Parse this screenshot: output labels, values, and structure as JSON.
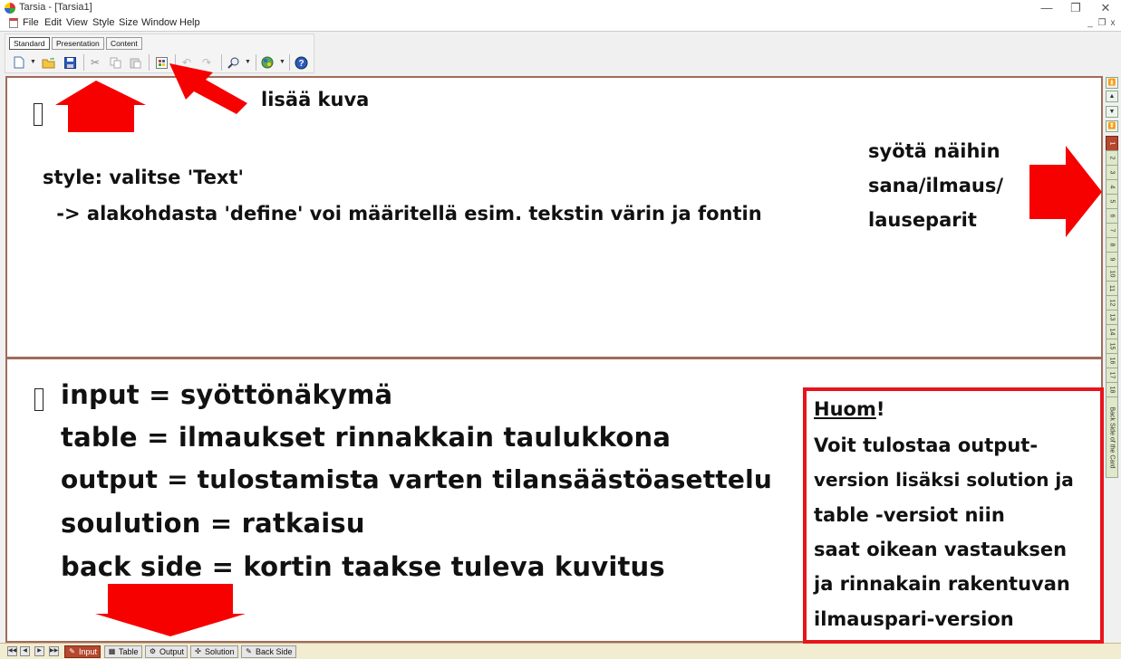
{
  "window": {
    "title": "Tarsia - [Tarsia1]",
    "controls": {
      "minimize": "—",
      "restore": "❐",
      "close": "✕"
    },
    "mdi_controls": {
      "minimize": "_",
      "restore": "❐",
      "close": "x"
    }
  },
  "menu": [
    "File",
    "Edit",
    "View",
    "Style",
    "Size",
    "Window",
    "Help"
  ],
  "style_tabs": {
    "standard": "Standard",
    "presentation": "Presentation",
    "content": "Content"
  },
  "toolbar_icons": [
    "new-icon",
    "open-icon",
    "save-icon",
    "cut-icon",
    "copy-icon",
    "paste-icon",
    "insert-picture-icon",
    "undo-icon",
    "redo-icon",
    "zoom-icon",
    "color-icon",
    "help-icon"
  ],
  "card_tabs": [
    "1",
    "2",
    "3",
    "4",
    "5",
    "6",
    "7",
    "8",
    "9",
    "10",
    "11",
    "12",
    "13",
    "14",
    "15",
    "16",
    "17",
    "18"
  ],
  "active_card": "1",
  "back_side_tab": "Back Side of the Card",
  "nav_glyphs": {
    "first": "⏫",
    "up": "▲",
    "down": "▼",
    "last": "⏬"
  },
  "bottom_nav": {
    "first": "◀◀",
    "prev": "◀",
    "next": "▶",
    "last": "▶▶"
  },
  "view_tabs": [
    {
      "label": "Input",
      "icon": "input-icon",
      "glyph": "✎",
      "active": true
    },
    {
      "label": "Table",
      "icon": "table-icon",
      "glyph": "▦",
      "active": false
    },
    {
      "label": "Output",
      "icon": "output-icon",
      "glyph": "⚙",
      "active": false
    },
    {
      "label": "Solution",
      "icon": "solution-icon",
      "glyph": "✣",
      "active": false
    },
    {
      "label": "Back Side",
      "icon": "back-side-icon",
      "glyph": "✎",
      "active": false
    }
  ],
  "annotations": {
    "insert_image": "lisää kuva",
    "style_line1": "style: valitse 'Text'",
    "style_line2": " -> alakohdasta 'define' voi määritellä esim. tekstin värin ja fontin",
    "enter_pairs": [
      "syötä näihin",
      "sana/ilmaus/",
      "lauseparit"
    ],
    "views": [
      "input = syöttönäkymä",
      "table = ilmaukset rinnakkain taulukkona",
      "output = tulostamista varten tilansäästöasettelu",
      "soulution = ratkaisu",
      "back side = kortin taakse tuleva kuvitus"
    ],
    "note_title": "Huom",
    "note_excl": "!",
    "note_lines": [
      "Voit tulostaa output-",
      "version lisäksi solution ja",
      "table -versiot niin",
      "saat oikean vastauksen",
      "ja rinnakain rakentuvan",
      "ilmauspari-version"
    ]
  },
  "colors": {
    "annotation_red": "#e8141c",
    "active_tab": "#b5482f",
    "panel_border": "#a06b5a",
    "card_tab_bg": "#dfe8c8",
    "bottom_bar_bg": "#f2ecd0"
  }
}
